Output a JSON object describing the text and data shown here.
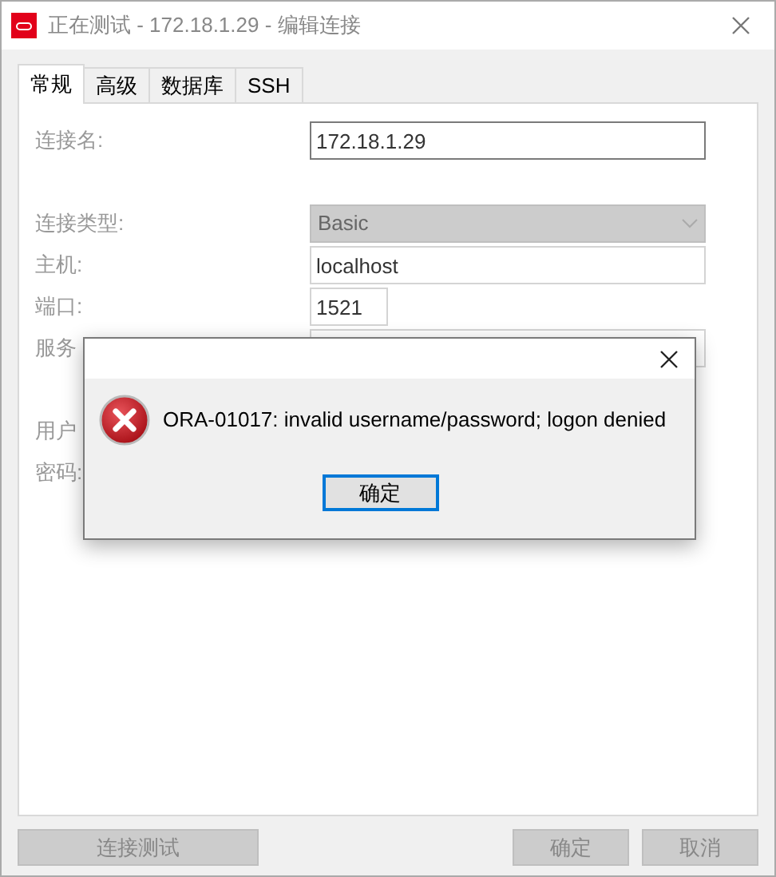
{
  "window": {
    "title": "正在测试 - 172.18.1.29 - 编辑连接"
  },
  "tabs": [
    {
      "label": "常规",
      "selected": true
    },
    {
      "label": "高级",
      "selected": false
    },
    {
      "label": "数据库",
      "selected": false
    },
    {
      "label": "SSH",
      "selected": false
    }
  ],
  "form": [
    {
      "kind": "text",
      "label": "连接名:",
      "value": "172.18.1.29",
      "focused": true
    },
    {
      "kind": "gap"
    },
    {
      "kind": "dropdown",
      "label": "连接类型:",
      "value": "Basic",
      "disabled": true
    },
    {
      "kind": "text",
      "label": "主机:",
      "value": "localhost",
      "focused": false
    },
    {
      "kind": "short",
      "label": "端口:",
      "value": "1521",
      "focused": false
    },
    {
      "kind": "text",
      "label": "服务",
      "focused": false
    },
    {
      "kind": "gap"
    },
    {
      "kind": "label",
      "label": "用户"
    },
    {
      "kind": "label",
      "label": "密码:"
    }
  ],
  "buttons": [
    {
      "label": "连接测试",
      "disabled": true
    },
    {
      "label": "确定",
      "disabled": true
    },
    {
      "label": "取消",
      "disabled": true
    }
  ],
  "dialog": {
    "message": "ORA-01017: invalid username/password; logon denied",
    "button": "确定"
  }
}
